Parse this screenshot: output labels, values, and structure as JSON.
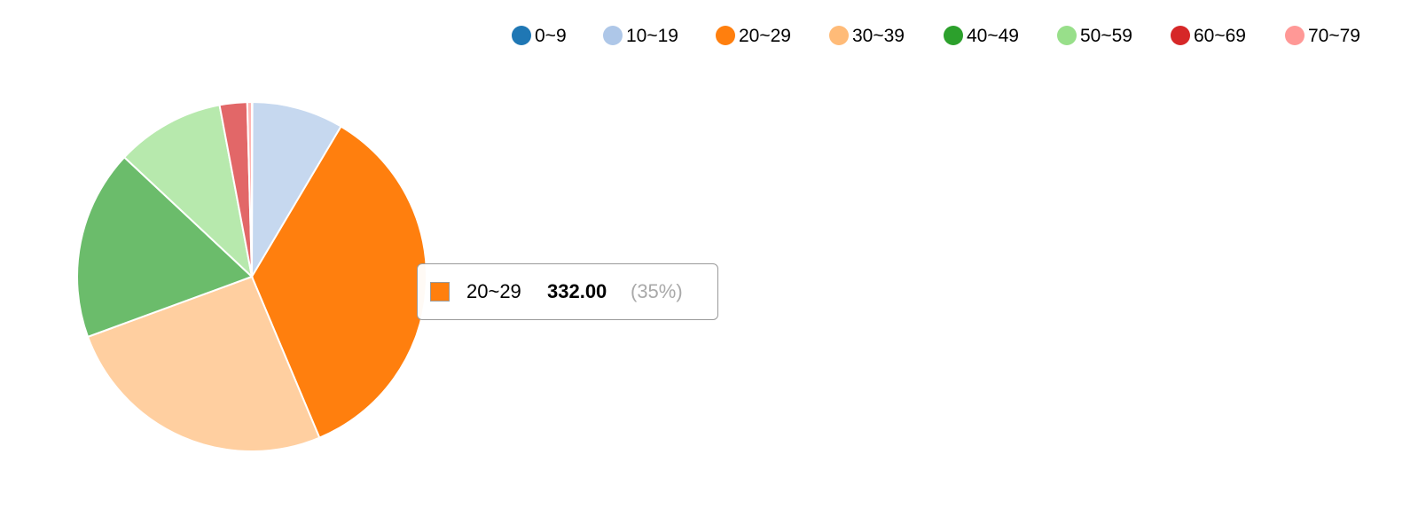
{
  "chart_data": {
    "type": "pie",
    "categories": [
      "0~9",
      "10~19",
      "20~29",
      "30~39",
      "40~49",
      "50~59",
      "60~69",
      "70~79"
    ],
    "values": [
      0.5,
      80,
      332,
      243,
      166,
      95,
      24,
      4
    ],
    "colors": [
      "#1f77b4",
      "#aec7e8",
      "#ff7f0e",
      "#ffbb78",
      "#2ca02c",
      "#98df8a",
      "#d62728",
      "#ff9896"
    ],
    "legend": {
      "position": "top-right",
      "entries": [
        "0~9",
        "10~19",
        "20~29",
        "30~39",
        "40~49",
        "50~59",
        "60~69",
        "70~79"
      ]
    },
    "tooltip": {
      "label": "20~29",
      "value": "332.00",
      "percent": "(35%)",
      "color": "#ff7f0e"
    }
  }
}
